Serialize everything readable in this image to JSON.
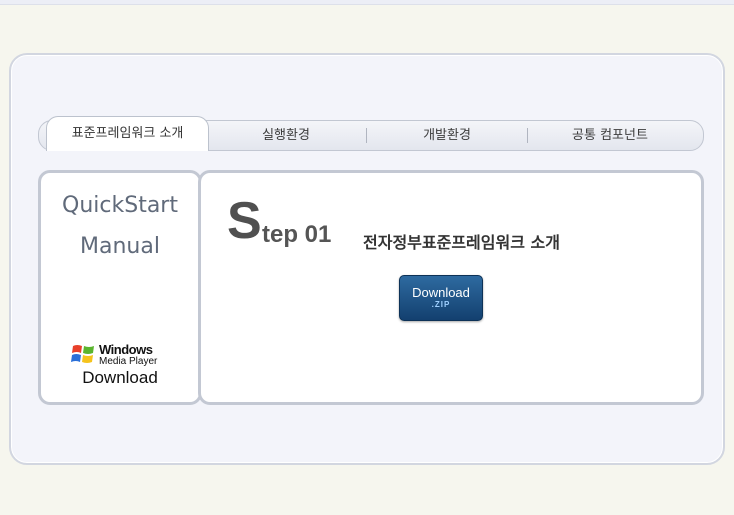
{
  "tabs": [
    {
      "label": "표준프레임워크 소개",
      "active": true
    },
    {
      "label": "실행환경",
      "active": false
    },
    {
      "label": "개발환경",
      "active": false
    },
    {
      "label": "공통 컴포넌트",
      "active": false
    }
  ],
  "sidebar": {
    "title_line1": "QuickStart",
    "title_line2": "Manual",
    "wmp_line1": "Windows",
    "wmp_line2": "Media Player",
    "wmp_download": "Download"
  },
  "main": {
    "step_letter": "S",
    "step_rest": "tep 01",
    "step_title": "전자정부표준프레임워크 소개",
    "download_label": "Download",
    "download_sub": ".ZIP"
  },
  "colors": {
    "flag_red": "#e8402a",
    "flag_green": "#5ab52e",
    "flag_blue": "#2a6fd8",
    "flag_yellow": "#f5c31c"
  }
}
